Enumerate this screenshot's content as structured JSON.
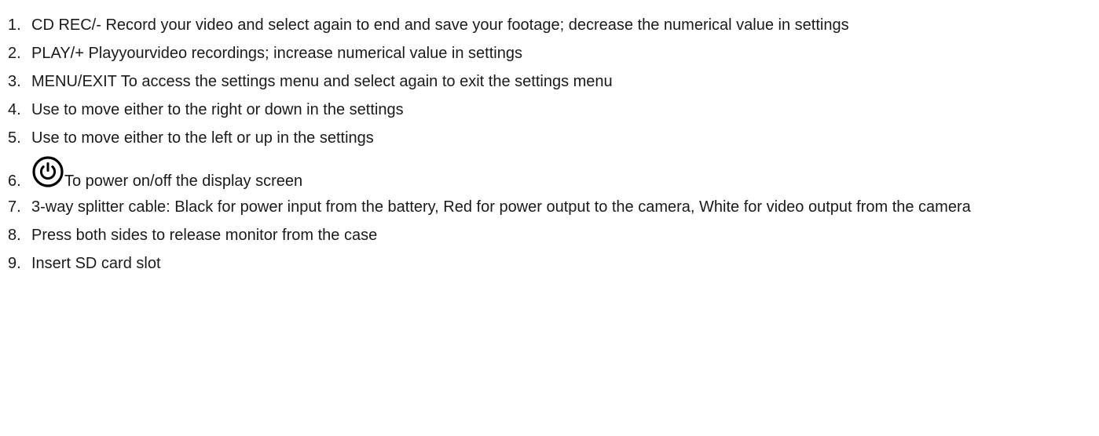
{
  "items": [
    {
      "num": "1.",
      "text": "CD REC/- Record your video and select again to end and save your footage; decrease the numerical value in settings"
    },
    {
      "num": "2.",
      "text": "PLAY/+ Playyourvideo recordings; increase numerical value in settings"
    },
    {
      "num": "3.",
      "text": "MENU/EXIT To access the settings menu and select again to exit the settings menu"
    },
    {
      "num": "4.",
      "text": "Use to move either to the right or down in the settings"
    },
    {
      "num": "5.",
      "text": "Use to move either to the left or up in the settings"
    },
    {
      "num": "6.",
      "text": "To power on/off the display screen",
      "icon": "power-icon"
    },
    {
      "num": "7.",
      "text": "3-way splitter cable: Black for power input from the battery, Red for power output to the camera, White for video output from the camera"
    },
    {
      "num": "8.",
      "text": "Press both sides to release monitor from the case"
    },
    {
      "num": "9.",
      "text": "Insert SD card slot"
    }
  ]
}
